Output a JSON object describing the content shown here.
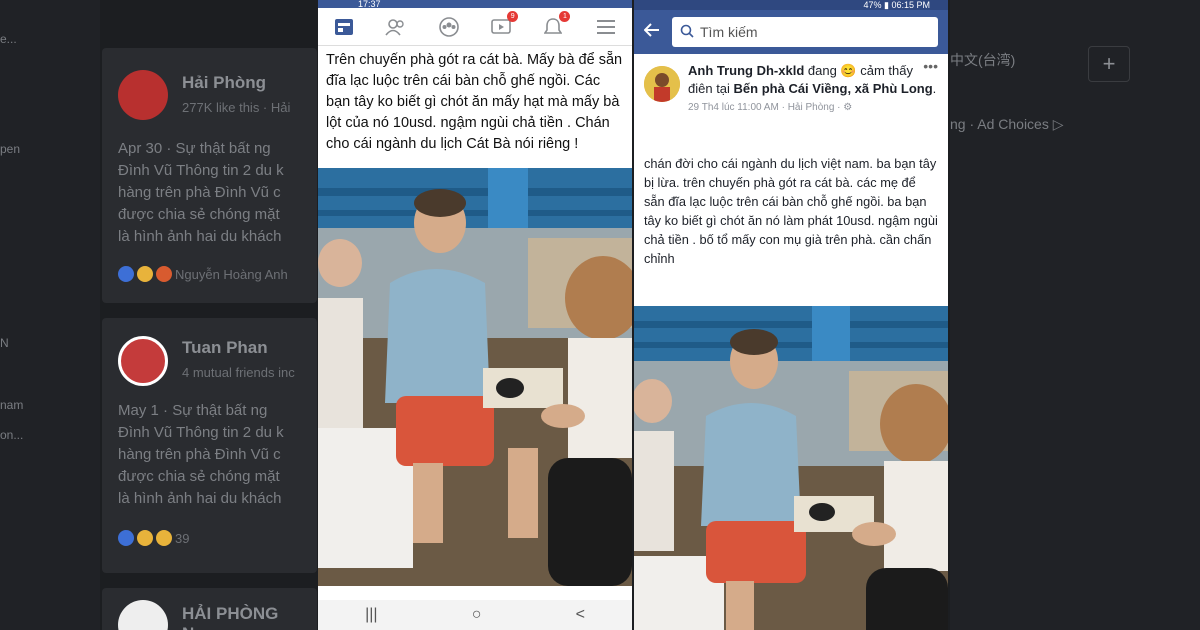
{
  "background": {
    "left_sidebar": [
      "e...",
      "pen",
      "N",
      "nam",
      "on..."
    ],
    "cards": [
      {
        "name": "Hải Phòng",
        "sub": "277K like this · Hải",
        "date_line": "Apr 30 · ",
        "lines": [
          "Sự thật bất ng",
          "Đình Vũ Thông tin 2 du k",
          "hàng trên phà Đình Vũ c",
          "được chia sẻ chóng mặt",
          "là hình ảnh hai du khách"
        ],
        "reaction_text": "Nguyễn Hoàng Anh"
      },
      {
        "name": "Tuan Phan",
        "sub": "4 mutual friends inc",
        "date_line": "May 1 · ",
        "lines": [
          "Sự thật bất ng",
          "Đình Vũ Thông tin 2 du k",
          "hàng trên phà Đình Vũ c",
          "được chia sẻ chóng mặt",
          "là hình ảnh hai du khách"
        ],
        "reaction_text": "39"
      },
      {
        "name": "HẢI PHÒNG New"
      }
    ],
    "right": {
      "lang": "中文(台湾)",
      "ad": "ng · Ad Choices ▷",
      "plus": "+"
    }
  },
  "phone1": {
    "status": "17:37",
    "post_text": "Trên chuyến phà gót ra cát bà. Mấy bà để sẵn đĩa lạc luộc trên cái bàn chỗ ghế ngồi. Các bạn tây ko biết gì chót ăn mấy hạt mà mấy bà lột của nó 10usd. ngậm ngùi chả tiền . Chán cho cái ngành du lịch Cát Bà nói riêng !",
    "badges": [
      "9",
      "1"
    ],
    "nav_buttons": [
      "|||",
      "○",
      "<"
    ]
  },
  "phone2": {
    "status": "47% ▮ 06:15 PM",
    "search_placeholder": "Tìm kiếm",
    "author": "Anh Trung Dh-xkld",
    "feeling": " đang 😊 cảm thấy điên tại ",
    "location": "Bến phà Cái Viềng, xã Phù Long",
    "meta": "29 Th4 lúc 11:00 AM · Hải Phòng · ⚙",
    "post_text": "chán đời cho cái ngành du lịch việt nam. ba bạn tây bị lừa. trên chuyến phà gót ra cát bà. các mẹ để sẵn đĩa lạc luộc trên cái bàn chỗ ghế ngồi. ba bạn tây ko biết gì chót ăn nó làm phát 10usd. ngậm ngùi chả tiền . bố tổ mấy con mụ già trên phà. cần chấn chỉnh"
  },
  "colors": {
    "fb_blue": "#3b5998",
    "badge_red": "#e53935",
    "shirt_blue": "#8fb3c9",
    "shorts_red": "#d9553b"
  }
}
